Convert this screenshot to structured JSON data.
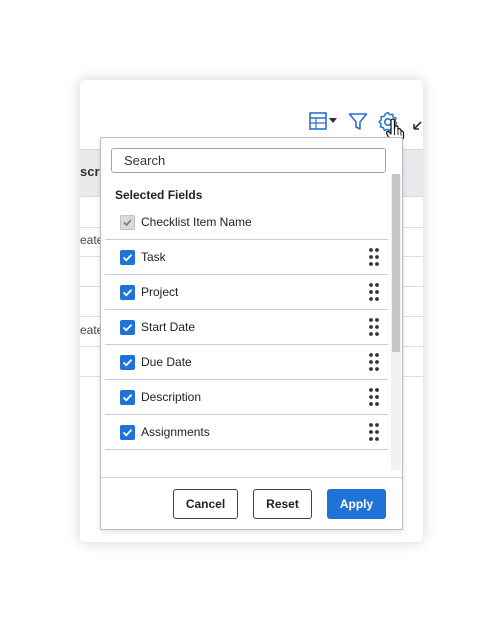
{
  "background": {
    "header_fragment": "scri",
    "row_fragments": [
      "eate",
      "eate"
    ]
  },
  "toolbar": {
    "icons": [
      "table-view-icon",
      "filter-icon",
      "gear-icon",
      "expand-icon"
    ]
  },
  "panel": {
    "search_placeholder": "Search",
    "section_title": "Selected Fields",
    "fields": [
      {
        "label": "Checklist Item Name",
        "checked": true,
        "locked": true
      },
      {
        "label": "Task",
        "checked": true,
        "locked": false
      },
      {
        "label": "Project",
        "checked": true,
        "locked": false
      },
      {
        "label": "Start Date",
        "checked": true,
        "locked": false
      },
      {
        "label": "Due Date",
        "checked": true,
        "locked": false
      },
      {
        "label": "Description",
        "checked": true,
        "locked": false
      },
      {
        "label": "Assignments",
        "checked": true,
        "locked": false
      }
    ],
    "buttons": {
      "cancel": "Cancel",
      "reset": "Reset",
      "apply": "Apply"
    }
  },
  "colors": {
    "accent": "#1f73d6",
    "icon": "#2b6fd1"
  }
}
